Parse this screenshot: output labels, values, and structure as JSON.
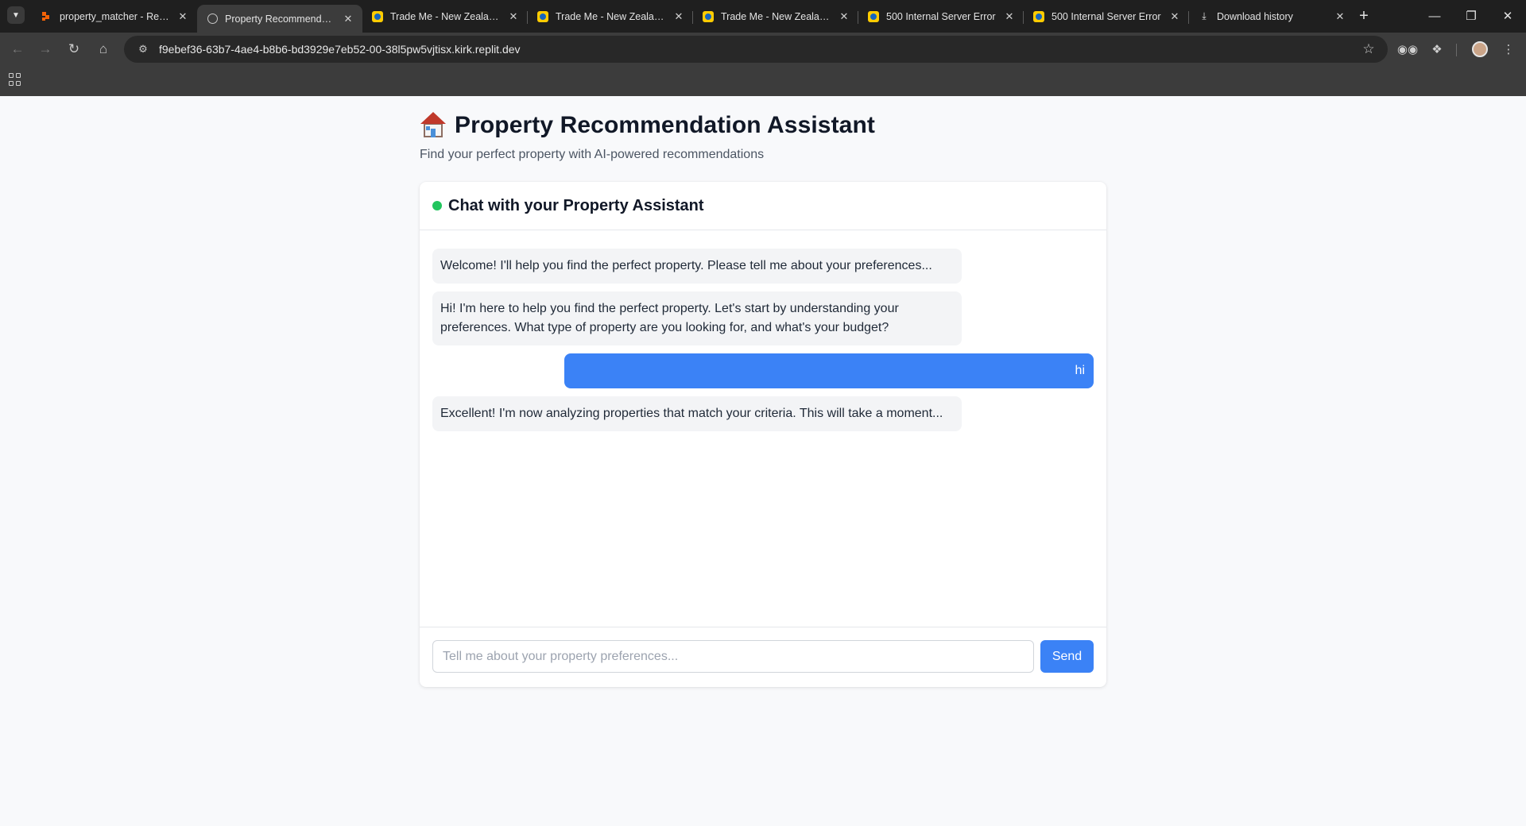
{
  "browser": {
    "tabs": [
      {
        "title": "property_matcher - Replit",
        "favicon": "replit-icon",
        "active": false
      },
      {
        "title": "Property Recommendation Assistant",
        "favicon": "globe-icon",
        "active": true
      },
      {
        "title": "Trade Me - New Zealand's",
        "favicon": "trademe-icon",
        "active": false
      },
      {
        "title": "Trade Me - New Zealand's",
        "favicon": "trademe-icon",
        "active": false
      },
      {
        "title": "Trade Me - New Zealand's",
        "favicon": "trademe-icon",
        "active": false
      },
      {
        "title": "500 Internal Server Error",
        "favicon": "trademe-icon",
        "active": false
      },
      {
        "title": "500 Internal Server Error",
        "favicon": "trademe-icon",
        "active": false
      },
      {
        "title": "Download history",
        "favicon": "download-icon",
        "active": false
      }
    ],
    "url": "f9ebef36-63b7-4ae4-b8b6-bd3929e7eb52-00-38l5pw5vjtisx.kirk.replit.dev"
  },
  "page": {
    "title": "Property Recommendation Assistant",
    "subtitle": "Find your perfect property with AI-powered recommendations"
  },
  "chat": {
    "header_title": "Chat with your Property Assistant",
    "status_color": "#22c55e",
    "messages": [
      {
        "role": "assistant",
        "text": "Welcome! I'll help you find the perfect property. Please tell me about your preferences..."
      },
      {
        "role": "assistant",
        "text": "Hi! I'm here to help you find the perfect property. Let's start by understanding your preferences. What type of property are you looking for, and what's your budget?"
      },
      {
        "role": "user",
        "text": "hi"
      },
      {
        "role": "assistant",
        "text": "Excellent! I'm now analyzing properties that match your criteria. This will take a moment..."
      }
    ],
    "input_placeholder": "Tell me about your property preferences...",
    "input_value": "",
    "send_label": "Send"
  },
  "colors": {
    "accent": "#3b82f6",
    "bot_bubble": "#f3f4f6",
    "page_background": "#f8f9fb"
  }
}
